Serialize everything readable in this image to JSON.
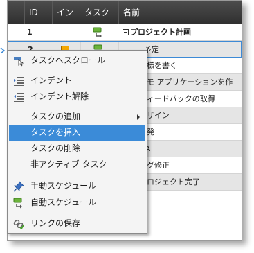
{
  "grid": {
    "columns": [
      "",
      "ID",
      "イン",
      "タスク",
      "名前"
    ],
    "rows": [
      {
        "id": "1",
        "name": "プロジェクト計画",
        "bold": true,
        "collapse": true
      },
      {
        "id": "2",
        "name": "予定"
      },
      {
        "id": "",
        "name": "仕様を書く"
      },
      {
        "id": "",
        "name": "デモ アプリケーションを作"
      },
      {
        "id": "",
        "name": "フィードバックの取得"
      },
      {
        "id": "",
        "name": "デザイン"
      },
      {
        "id": "",
        "name": "開発"
      },
      {
        "id": "",
        "name": "QA"
      },
      {
        "id": "",
        "name": "バグ修正"
      },
      {
        "id": "",
        "name": "プロジェクト完了"
      }
    ]
  },
  "menu": {
    "scroll_to_task": "タスクへスクロール",
    "indent": "インデント",
    "outdent": "インデント解除",
    "add_task": "タスクの追加",
    "insert_task": "タスクを挿入",
    "delete_task": "タスクの削除",
    "inactivate_task": "非アクティブ タスク",
    "manual_schedule": "手動スケジュール",
    "auto_schedule": "自動スケジュール",
    "save_links": "リンクの保存"
  },
  "colors": {
    "header_bg": "#3a3a3a",
    "highlight": "#3b8bd8",
    "alt_row": "#e5e5e5",
    "task_icon_green": "#6bb33a"
  }
}
